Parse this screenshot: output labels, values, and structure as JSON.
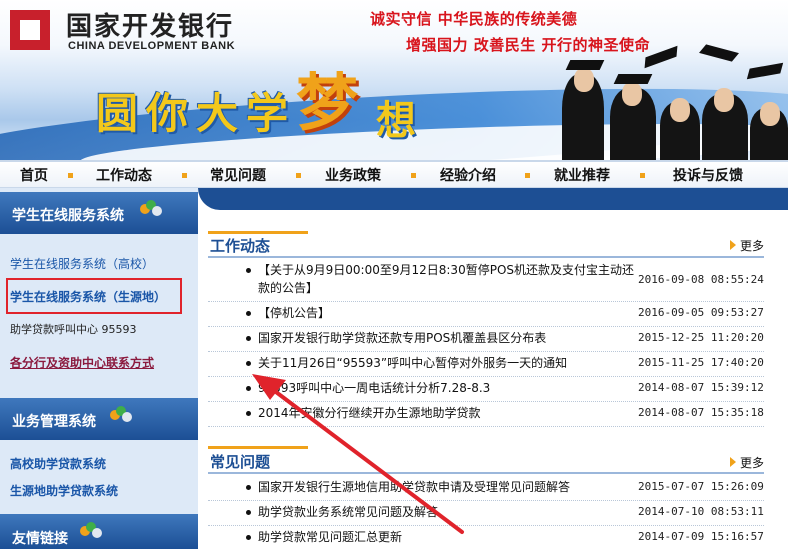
{
  "header": {
    "bank_name_cn": "国家开发银行",
    "bank_name_en": "CHINA DEVELOPMENT BANK",
    "slogan_line1": "诚实守信  中华民族的传统美德",
    "slogan_line2": "增强国力 改善民生  开行的神圣使命",
    "banner_text_a": "圆你大学",
    "banner_text_b": "梦",
    "banner_text_c": "想"
  },
  "nav": {
    "items": [
      {
        "label": "首页"
      },
      {
        "label": "工作动态"
      },
      {
        "label": "常见问题"
      },
      {
        "label": "业务政策"
      },
      {
        "label": "经验介绍"
      },
      {
        "label": "就业推荐"
      },
      {
        "label": "投诉与反馈"
      }
    ]
  },
  "sidebar": {
    "section1_title": "学生在线服务系统",
    "link_gaoxiao": "学生在线服务系统（高校）",
    "link_shengyuandi": "学生在线服务系统（生源地）",
    "hotline": "助学贷款呼叫中心 95593",
    "contact_link": "各分行及资助中心联系方式",
    "section2_title": "业务管理系统",
    "link_gaoxiao_loan": "高校助学贷款系统",
    "link_shengyuandi_loan": "生源地助学贷款系统",
    "section3_title": "友情链接"
  },
  "main": {
    "work_news": {
      "title": "工作动态",
      "more": "更多",
      "items": [
        {
          "title_line1": "【关于从9月9日00:00至9月12日8:30暂停POS机还款及支付宝主动还",
          "title_line2": "款的公告】",
          "date": "2016-09-08 08:55:24"
        },
        {
          "title_line1": "【停机公告】",
          "date": "2016-09-05 09:53:27"
        },
        {
          "title_line1": "国家开发银行助学贷款还款专用POS机覆盖县区分布表",
          "date": "2015-12-25 11:20:20"
        },
        {
          "title_line1": "关于11月26日“95593”呼叫中心暂停对外服务一天的通知",
          "date": "2015-11-25 17:40:20"
        },
        {
          "title_line1": "95593呼叫中心一周电话统计分析7.28-8.3",
          "date": "2014-08-07 15:39:12"
        },
        {
          "title_line1": "2014年安徽分行继续开办生源地助学贷款",
          "date": "2014-08-07 15:35:18"
        }
      ]
    },
    "faq": {
      "title": "常见问题",
      "more": "更多",
      "items": [
        {
          "title_line1": "国家开发银行生源地信用助学贷款申请及受理常见问题解答",
          "date": "2015-07-07 15:26:09"
        },
        {
          "title_line1": "助学贷款业务系统常见问题及解答",
          "date": "2014-07-10 08:53:11"
        },
        {
          "title_line1": "助学贷款常见问题汇总更新",
          "date": "2014-07-09 15:16:57"
        }
      ]
    }
  },
  "colors": {
    "brand_red": "#c8202c",
    "slogan_red": "#d8141c",
    "nav_blue": "#1d4f94",
    "accent_orange": "#f0a21a",
    "sidebar_bg": "#dde9f7",
    "link_blue": "#1a56a8",
    "annotation_red": "#e0232b"
  },
  "icons": [
    "bank-logo-icon",
    "people-icon",
    "more-arrow-icon",
    "bullet-icon"
  ]
}
